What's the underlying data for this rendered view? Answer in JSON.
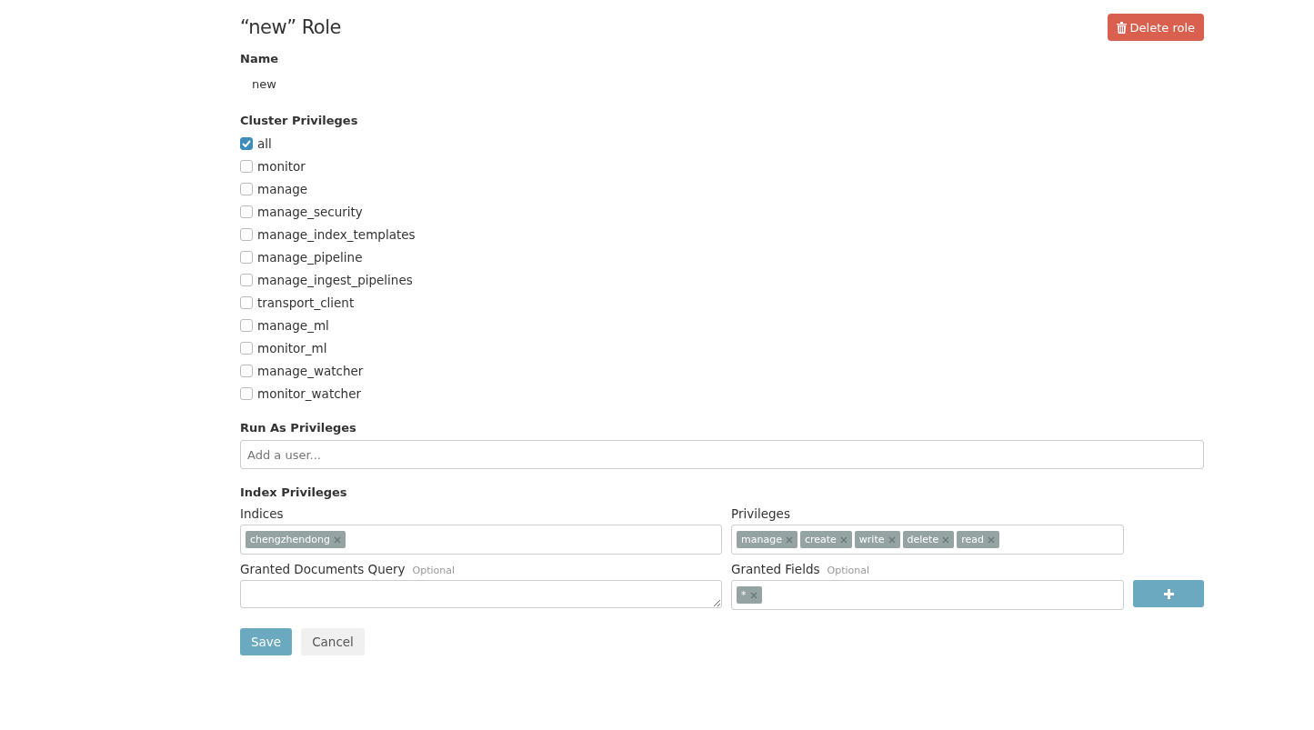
{
  "title": "“new” Role",
  "delete_button": "Delete role",
  "name": {
    "label": "Name",
    "value": "new"
  },
  "cluster_privileges": {
    "label": "Cluster Privileges",
    "items": [
      {
        "label": "all",
        "checked": true
      },
      {
        "label": "monitor",
        "checked": false
      },
      {
        "label": "manage",
        "checked": false
      },
      {
        "label": "manage_security",
        "checked": false
      },
      {
        "label": "manage_index_templates",
        "checked": false
      },
      {
        "label": "manage_pipeline",
        "checked": false
      },
      {
        "label": "manage_ingest_pipelines",
        "checked": false
      },
      {
        "label": "transport_client",
        "checked": false
      },
      {
        "label": "manage_ml",
        "checked": false
      },
      {
        "label": "monitor_ml",
        "checked": false
      },
      {
        "label": "manage_watcher",
        "checked": false
      },
      {
        "label": "monitor_watcher",
        "checked": false
      }
    ]
  },
  "run_as": {
    "label": "Run As Privileges",
    "placeholder": "Add a user..."
  },
  "index_privileges": {
    "label": "Index Privileges",
    "indices": {
      "label": "Indices",
      "tags": [
        "chengzhendong"
      ]
    },
    "privileges": {
      "label": "Privileges",
      "tags": [
        "manage",
        "create",
        "write",
        "delete",
        "read"
      ]
    },
    "query": {
      "label": "Granted Documents Query",
      "hint": "Optional"
    },
    "fields": {
      "label": "Granted Fields",
      "hint": "Optional",
      "tags": [
        "*"
      ]
    }
  },
  "buttons": {
    "save": "Save",
    "cancel": "Cancel"
  }
}
